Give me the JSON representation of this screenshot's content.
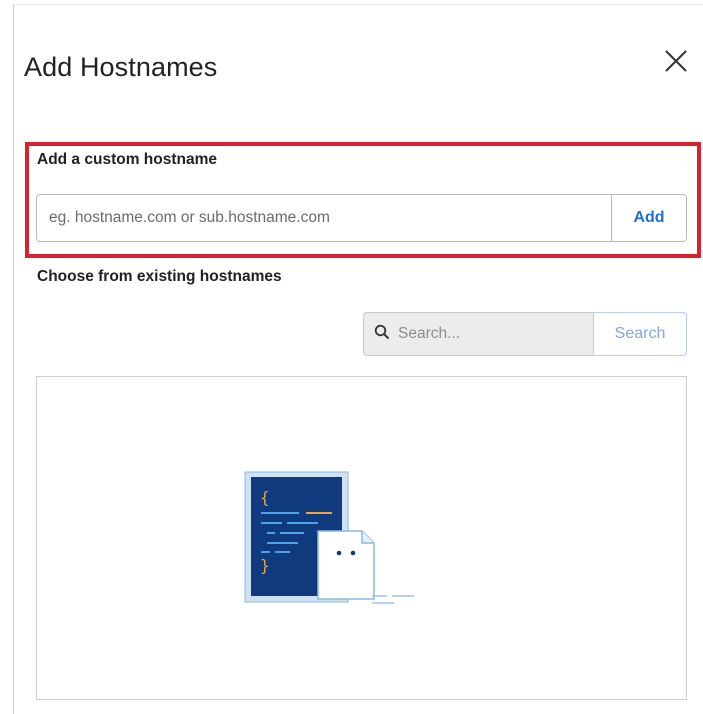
{
  "dialog": {
    "title": "Add Hostnames",
    "close_icon": "close-icon"
  },
  "custom_hostname": {
    "label": "Add a custom hostname",
    "input_value": "",
    "input_placeholder": "eg. hostname.com or sub.hostname.com",
    "add_label": "Add"
  },
  "existing_hostnames": {
    "label": "Choose from existing hostnames",
    "search_placeholder": "Search...",
    "search_value": "",
    "search_button_label": "Search",
    "search_icon": "search-icon",
    "empty_illustration_icon": "empty-document-icon"
  },
  "colors": {
    "accent": "#1f6fcf",
    "highlight_border": "#d6232e",
    "illustration_navy": "#0f3a7e",
    "illustration_orange": "#f0a33a"
  }
}
